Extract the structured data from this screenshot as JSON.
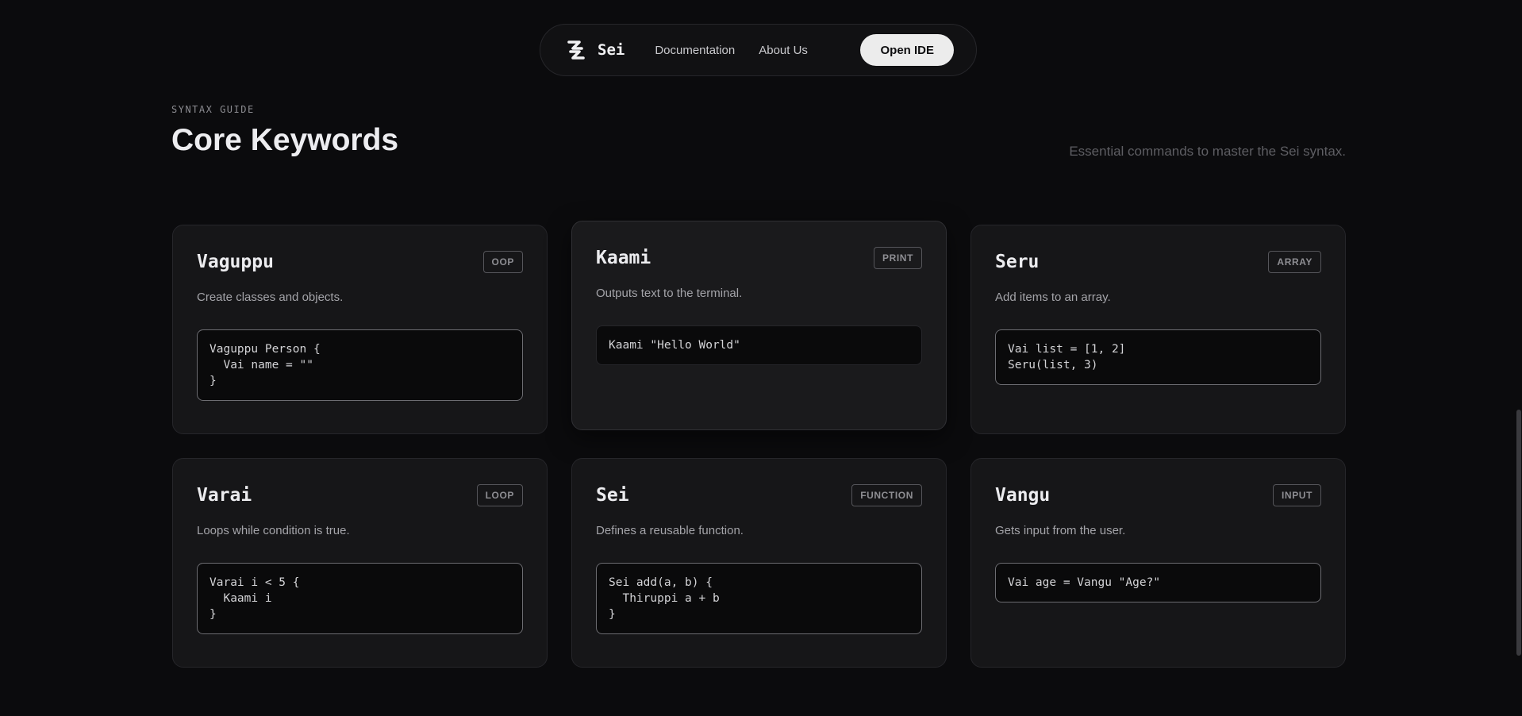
{
  "nav": {
    "brand": "Sei",
    "links": [
      "Documentation",
      "About Us"
    ],
    "cta": "Open IDE"
  },
  "header": {
    "eyebrow": "SYNTAX GUIDE",
    "title": "Core Keywords",
    "subtitle": "Essential commands to master the Sei syntax."
  },
  "cards": [
    {
      "title": "Vaguppu",
      "badge": "OOP",
      "desc": "Create classes and objects.",
      "code": "Vaguppu Person {\n  Vai name = \"\"\n}"
    },
    {
      "title": "Kaami",
      "badge": "PRINT",
      "desc": "Outputs text to the terminal.",
      "code": "Kaami \"Hello World\""
    },
    {
      "title": "Seru",
      "badge": "ARRAY",
      "desc": "Add items to an array.",
      "code": "Vai list = [1, 2]\nSeru(list, 3)"
    },
    {
      "title": "Varai",
      "badge": "LOOP",
      "desc": "Loops while condition is true.",
      "code": "Varai i < 5 {\n  Kaami i\n}"
    },
    {
      "title": "Sei",
      "badge": "FUNCTION",
      "desc": "Defines a reusable function.",
      "code": "Sei add(a, b) {\n  Thiruppi a + b\n}"
    },
    {
      "title": "Vangu",
      "badge": "INPUT",
      "desc": "Gets input from the user.",
      "code": "Vai age = Vangu \"Age?\""
    }
  ],
  "colors": {
    "background": "#0b0b0d",
    "card": "#161618",
    "cta_bg": "#ececec"
  }
}
